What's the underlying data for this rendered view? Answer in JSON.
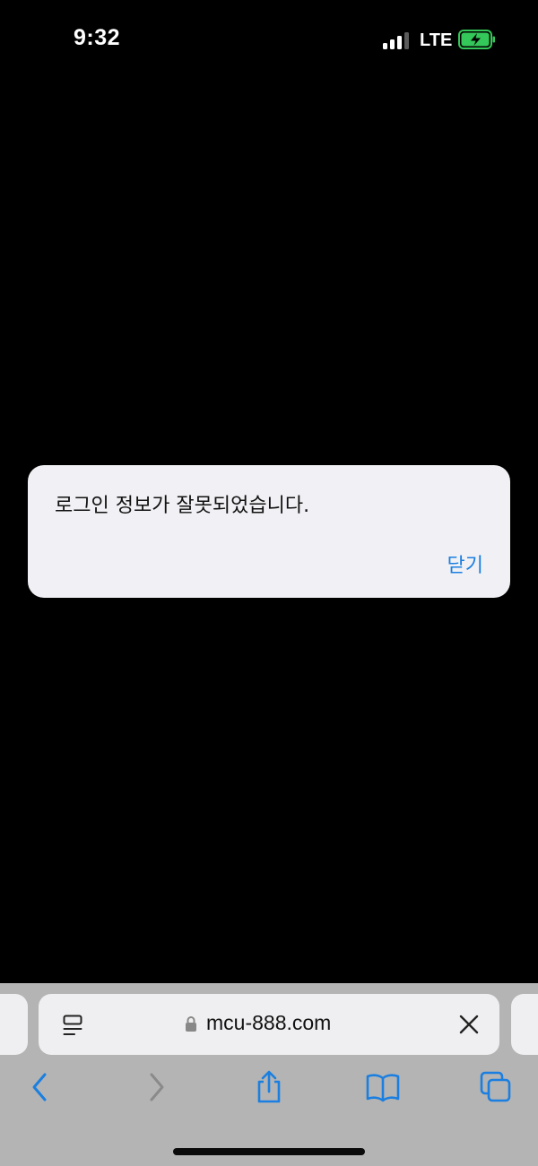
{
  "status_bar": {
    "time": "9:32",
    "network": "LTE",
    "signal_bars_active": 3,
    "signal_bars_total": 4,
    "battery_state": "charging",
    "battery_color": "#34c759"
  },
  "alert": {
    "message": "로그인 정보가 잘못되었습니다.",
    "close_label": "닫기",
    "button_color": "#1a7fe0"
  },
  "address_bar": {
    "url": "mcu-888.com",
    "reader_icon": "page-format-icon",
    "lock_icon": "lock-icon",
    "clear_icon": "close-icon"
  },
  "toolbar": {
    "items": [
      "back-icon",
      "forward-icon",
      "share-icon",
      "bookmarks-icon",
      "tabs-icon"
    ],
    "accent": "#1a7fe0"
  }
}
